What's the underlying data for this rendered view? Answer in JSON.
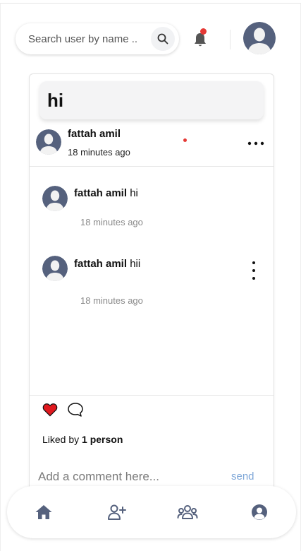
{
  "header": {
    "search_placeholder": "Search user by name ..",
    "icons": {
      "search": "search-icon",
      "bell": "bell-icon",
      "avatar": "user-avatar"
    },
    "notification_dot_color": "#e53935"
  },
  "post": {
    "caption": "hi",
    "author": "fattah amil",
    "time": "18 minutes ago",
    "likes_prefix": "Liked by",
    "likes_count": "1 person",
    "liked": true,
    "comment_placeholder": "Add a comment here...",
    "send_label": "send",
    "accent_color": "#7ea7d8",
    "heart_color": "#e0191e"
  },
  "comments": [
    {
      "author": "fattah amil",
      "text": "hi",
      "time": "18 minutes ago"
    },
    {
      "author": "fattah amil",
      "text": "hii",
      "time": "18 minutes ago"
    }
  ],
  "nav": {
    "items": [
      "home-icon",
      "add-friend-icon",
      "groups-icon",
      "profile-icon"
    ]
  }
}
